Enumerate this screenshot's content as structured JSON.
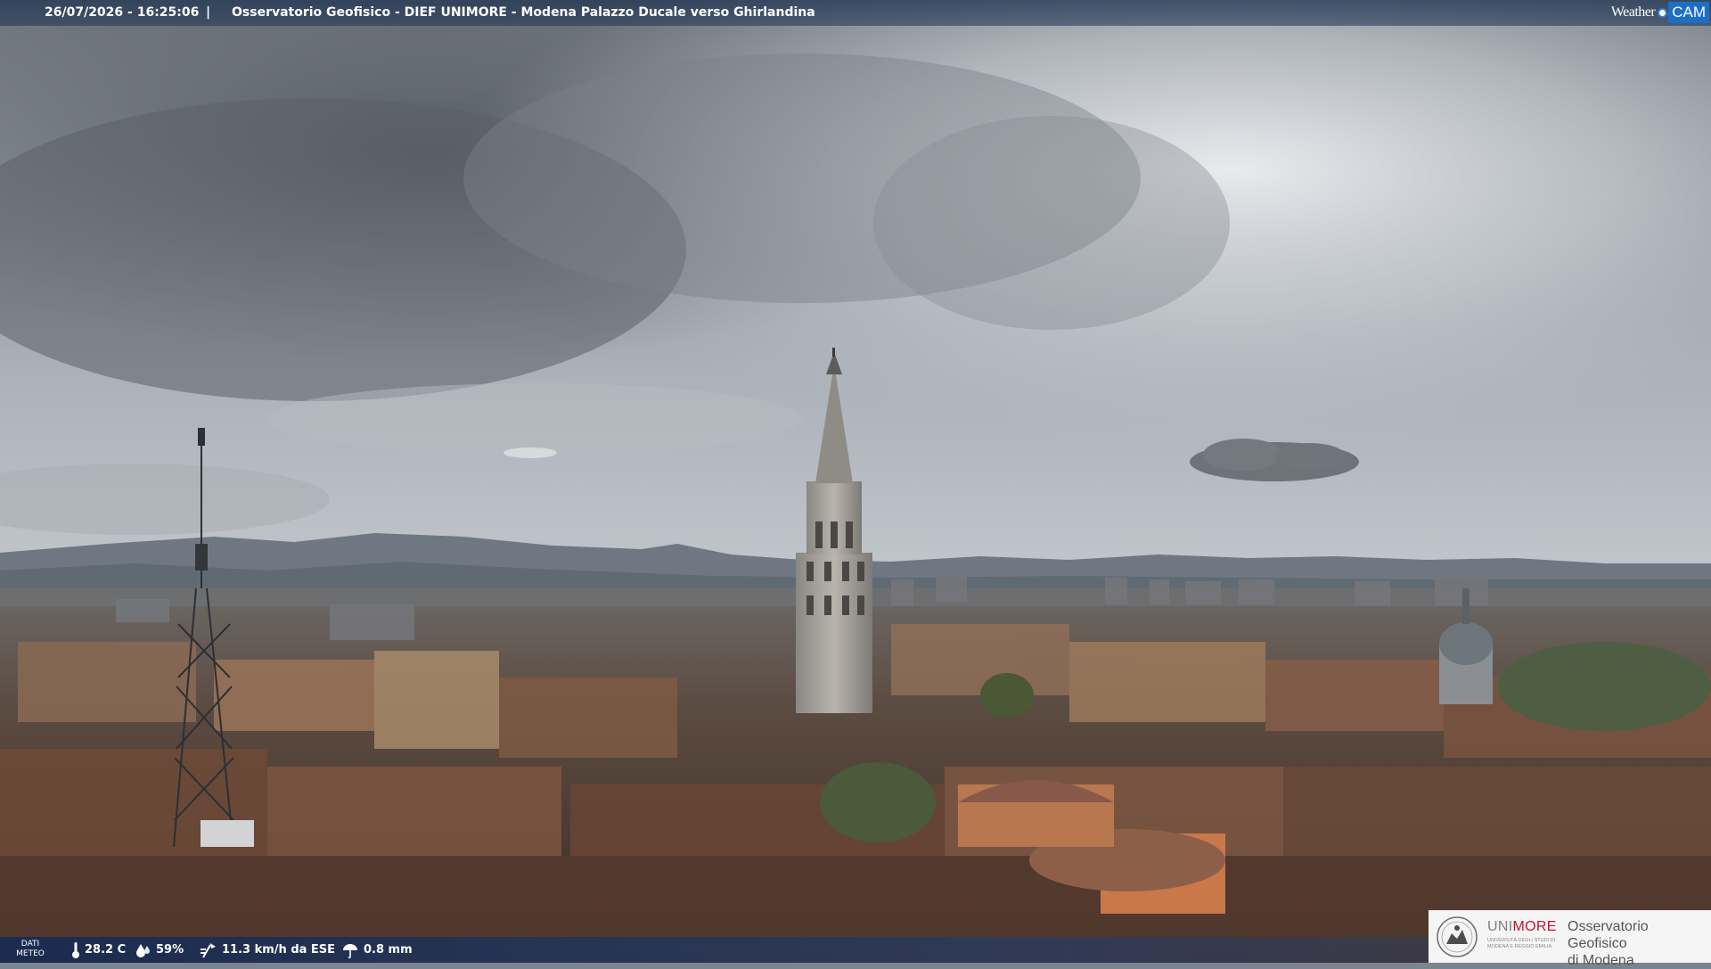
{
  "header": {
    "timestamp": "26/07/2026 - 16:25:06",
    "separator": "|",
    "title": "Osservatorio Geofisico - DIEF UNIMORE - Modena Palazzo Ducale verso Ghirlandina"
  },
  "brand": {
    "weather": "Weather",
    "cam": "CAM"
  },
  "weather_bar": {
    "label_line1": "DATI",
    "label_line2": "METEO",
    "temperature": "28.2 C",
    "humidity": "59%",
    "wind": "11.3 km/h da ESE",
    "rain": "0.8 mm"
  },
  "institution": {
    "name_part1": "UNI",
    "name_part2": "MORE",
    "subtitle_line1": "UNIVERSITÀ DEGLI STUDI DI",
    "subtitle_line2": "MODENA E REGGIO EMILIA",
    "observatory_line1": "Osservatorio Geofisico",
    "observatory_line2": "di Modena"
  },
  "colors": {
    "bar_text": "#ffffff",
    "brand_blue": "#1d6fc6",
    "unimore_red": "#c8102e"
  }
}
